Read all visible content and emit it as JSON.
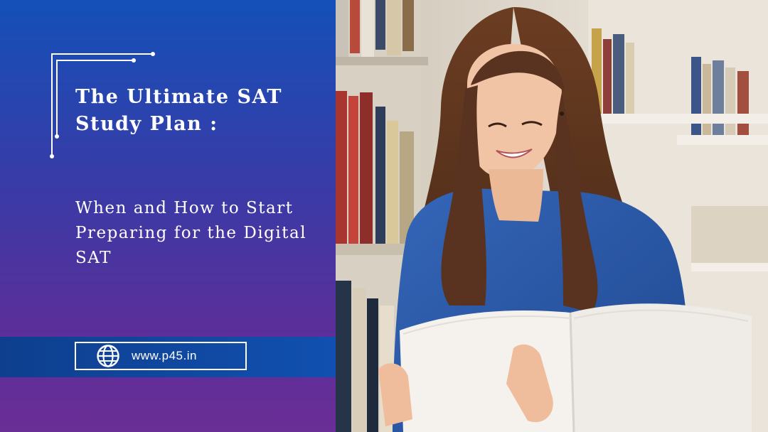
{
  "banner": {
    "title": "The Ultimate SAT Study Plan :",
    "subtitle": "When and How to Start Preparing for the Digital SAT",
    "website": "www.p45.in",
    "website_icon": "globe-icon"
  },
  "colors": {
    "gradient_top": "#1450b8",
    "gradient_bottom": "#6a2e96",
    "band": "#1150b0",
    "text": "#ffffff"
  },
  "photo": {
    "subject": "smiling-student-reading-book-in-library",
    "colors": {
      "shelf": "#e4ddd2",
      "hair": "#5a3320",
      "skin": "#f2c4a6",
      "sweater": "#2a58a8",
      "book": "#f5f2ee"
    }
  }
}
